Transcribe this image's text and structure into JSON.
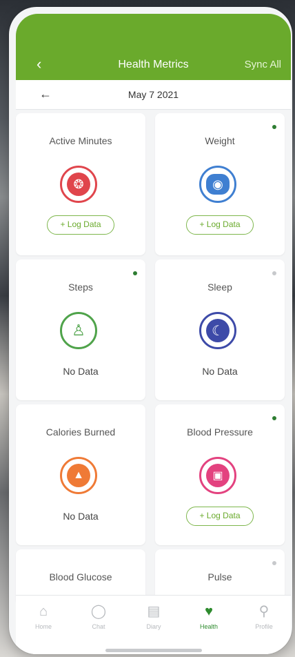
{
  "header": {
    "back_icon": "chevron-left-icon",
    "title": "Health Metrics",
    "sync_label": "Sync All",
    "color": "#6aaa2c"
  },
  "datebar": {
    "arrow_icon": "arrow-left-icon",
    "date": "May 7 2021"
  },
  "cards": [
    {
      "title": "Active Minutes",
      "icon": "person-running-icon",
      "color": "#e0454c",
      "action": "+ Log Data",
      "indicator": false
    },
    {
      "title": "Weight",
      "icon": "scale-icon",
      "color": "#3f7fd1",
      "action": "+ Log Data",
      "indicator": true
    },
    {
      "title": "Steps",
      "icon": "walking-icon",
      "color": "#4fa34a",
      "status": "No Data",
      "indicator": true
    },
    {
      "title": "Sleep",
      "icon": "moon-icon",
      "color": "#3d4aa8",
      "status": "No Data",
      "indicator": "light"
    },
    {
      "title": "Calories Burned",
      "icon": "flame-icon",
      "color": "#ef7a36",
      "status": "No Data",
      "indicator": false
    },
    {
      "title": "Blood Pressure",
      "icon": "blood-pressure-icon",
      "color": "#e3427f",
      "action": "+ Log Data",
      "indicator": true
    },
    {
      "title": "Blood Glucose",
      "indicator": false
    },
    {
      "title": "Pulse",
      "indicator": "light"
    }
  ],
  "tabs": [
    {
      "label": "Home",
      "icon": "home-icon"
    },
    {
      "label": "Chat",
      "icon": "chat-icon"
    },
    {
      "label": "Diary",
      "icon": "diary-icon"
    },
    {
      "label": "Health",
      "icon": "heart-icon",
      "active": true
    },
    {
      "label": "Profile",
      "icon": "user-icon"
    }
  ]
}
